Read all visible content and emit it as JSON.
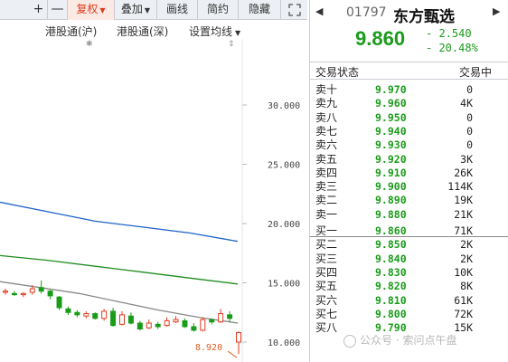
{
  "toolbar": {
    "plus": "+",
    "minus": "—",
    "fuquan": "复权",
    "diejia": "叠加",
    "huaxian": "画线",
    "jianyue": "简约",
    "yincang": "隐藏",
    "expand_icon": "expand-icon"
  },
  "chart_header": {
    "hk_connect_sh": "港股通(沪)",
    "hk_connect_sz": "港股通(深)",
    "ma_settings": "设置均线"
  },
  "chart_data": {
    "type": "candlestick",
    "yticks": [
      "30.000",
      "25.000",
      "20.000",
      "15.000",
      "10.000"
    ],
    "ylim": [
      8.0,
      33.0
    ],
    "low_label": "8.920",
    "ma_long": {
      "color": "#1e64c8",
      "values": [
        21.8,
        21.0,
        20.2,
        19.7,
        19.2,
        18.5
      ]
    },
    "ma_mid": {
      "color": "#1f8c1f",
      "values": [
        17.3,
        16.9,
        16.4,
        15.9,
        15.4,
        14.9
      ]
    },
    "ma_short": {
      "color": "#888888",
      "values": [
        15.1,
        14.6,
        14.1,
        13.4,
        12.7,
        12.1,
        11.6
      ]
    },
    "candles": [
      {
        "o": 14.2,
        "c": 14.3,
        "h": 14.5,
        "l": 14.0
      },
      {
        "o": 14.1,
        "c": 14.0,
        "h": 14.3,
        "l": 13.9
      },
      {
        "o": 14.0,
        "c": 14.1,
        "h": 14.2,
        "l": 13.8
      },
      {
        "o": 14.2,
        "c": 14.5,
        "h": 14.8,
        "l": 14.0
      },
      {
        "o": 14.6,
        "c": 14.3,
        "h": 15.2,
        "l": 14.1
      },
      {
        "o": 14.3,
        "c": 13.9,
        "h": 14.4,
        "l": 13.6
      },
      {
        "o": 13.8,
        "c": 12.9,
        "h": 13.9,
        "l": 12.7
      },
      {
        "o": 12.8,
        "c": 12.5,
        "h": 13.0,
        "l": 12.3
      },
      {
        "o": 12.5,
        "c": 12.3,
        "h": 12.7,
        "l": 12.1
      },
      {
        "o": 12.2,
        "c": 12.4,
        "h": 12.6,
        "l": 12.0
      },
      {
        "o": 12.4,
        "c": 12.0,
        "h": 12.5,
        "l": 11.9
      },
      {
        "o": 12.0,
        "c": 12.6,
        "h": 12.8,
        "l": 11.8
      },
      {
        "o": 12.6,
        "c": 11.4,
        "h": 12.9,
        "l": 11.3
      },
      {
        "o": 11.5,
        "c": 12.3,
        "h": 12.6,
        "l": 11.4
      },
      {
        "o": 12.2,
        "c": 11.6,
        "h": 12.5,
        "l": 11.5
      },
      {
        "o": 11.6,
        "c": 11.1,
        "h": 11.8,
        "l": 11.0
      },
      {
        "o": 11.2,
        "c": 11.6,
        "h": 11.9,
        "l": 11.1
      },
      {
        "o": 11.5,
        "c": 11.3,
        "h": 11.7,
        "l": 11.1
      },
      {
        "o": 11.4,
        "c": 11.8,
        "h": 12.1,
        "l": 11.3
      },
      {
        "o": 11.7,
        "c": 11.9,
        "h": 12.2,
        "l": 11.6
      },
      {
        "o": 11.8,
        "c": 11.3,
        "h": 12.0,
        "l": 11.2
      },
      {
        "o": 11.3,
        "c": 11.0,
        "h": 11.6,
        "l": 10.9
      },
      {
        "o": 11.0,
        "c": 11.9,
        "h": 12.1,
        "l": 10.9
      },
      {
        "o": 11.9,
        "c": 11.7,
        "h": 12.0,
        "l": 11.5
      },
      {
        "o": 11.7,
        "c": 12.4,
        "h": 12.8,
        "l": 11.6
      },
      {
        "o": 12.3,
        "c": 12.0,
        "h": 12.6,
        "l": 11.7
      },
      {
        "o": 10.0,
        "c": 10.8,
        "h": 10.9,
        "l": 9.0
      }
    ]
  },
  "quote": {
    "prev_arrow": "◀",
    "next_arrow": "▶",
    "code": "01797",
    "name": "东方甄选",
    "price": "9.860",
    "change": "- 2.540",
    "change_pct": "- 20.48%",
    "status_label": "交易状态",
    "status_value": "交易中"
  },
  "order_book": [
    {
      "label": "卖十",
      "price": "9.970",
      "vol": "0"
    },
    {
      "label": "卖九",
      "price": "9.960",
      "vol": "4K"
    },
    {
      "label": "卖八",
      "price": "9.950",
      "vol": "0"
    },
    {
      "label": "卖七",
      "price": "9.940",
      "vol": "0"
    },
    {
      "label": "卖六",
      "price": "9.930",
      "vol": "0"
    },
    {
      "label": "卖五",
      "price": "9.920",
      "vol": "3K"
    },
    {
      "label": "卖四",
      "price": "9.910",
      "vol": "26K"
    },
    {
      "label": "卖三",
      "price": "9.900",
      "vol": "114K"
    },
    {
      "label": "卖二",
      "price": "9.890",
      "vol": "19K"
    },
    {
      "label": "卖一",
      "price": "9.880",
      "vol": "21K"
    },
    {
      "label": "买一",
      "price": "9.860",
      "vol": "71K"
    },
    {
      "label": "买二",
      "price": "9.850",
      "vol": "2K"
    },
    {
      "label": "买三",
      "price": "9.840",
      "vol": "2K"
    },
    {
      "label": "买四",
      "price": "9.830",
      "vol": "10K"
    },
    {
      "label": "买五",
      "price": "9.820",
      "vol": "8K"
    },
    {
      "label": "买六",
      "price": "9.810",
      "vol": "61K"
    },
    {
      "label": "买七",
      "price": "9.800",
      "vol": "72K"
    },
    {
      "label": "买八",
      "price": "9.790",
      "vol": "15K"
    }
  ],
  "watermark": {
    "text": "公众号 · 索问点午盘"
  },
  "colors": {
    "up": "#e03c1e",
    "down": "#1a9c1a",
    "accent": "#e03c1e"
  }
}
